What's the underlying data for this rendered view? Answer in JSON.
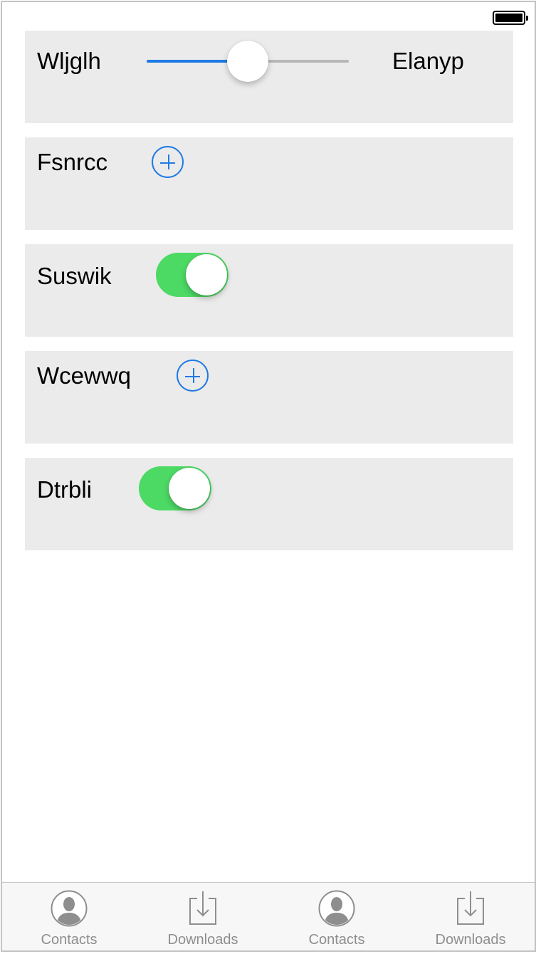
{
  "status_bar": {
    "battery_icon": "battery-full-icon"
  },
  "rows": [
    {
      "type": "slider",
      "label": "Wljglh",
      "value_label": "Elanyp",
      "slider_value": 0.5
    },
    {
      "type": "add",
      "label": "Fsnrcc",
      "icon": "plus-circle-icon"
    },
    {
      "type": "toggle",
      "label": "Suswik",
      "on": true
    },
    {
      "type": "add",
      "label": "Wcewwq",
      "icon": "plus-circle-icon"
    },
    {
      "type": "toggle",
      "label": "Dtrbli",
      "on": true
    }
  ],
  "tab_bar": {
    "tabs": [
      {
        "label": "Contacts",
        "icon": "contact-icon"
      },
      {
        "label": "Downloads",
        "icon": "download-icon"
      },
      {
        "label": "Contacts",
        "icon": "contact-icon"
      },
      {
        "label": "Downloads",
        "icon": "download-icon"
      }
    ]
  },
  "colors": {
    "accent": "#1f7ae6",
    "toggle_on": "#4cd964",
    "row_background": "#ebebeb",
    "tab_label": "#8e8e8e"
  }
}
